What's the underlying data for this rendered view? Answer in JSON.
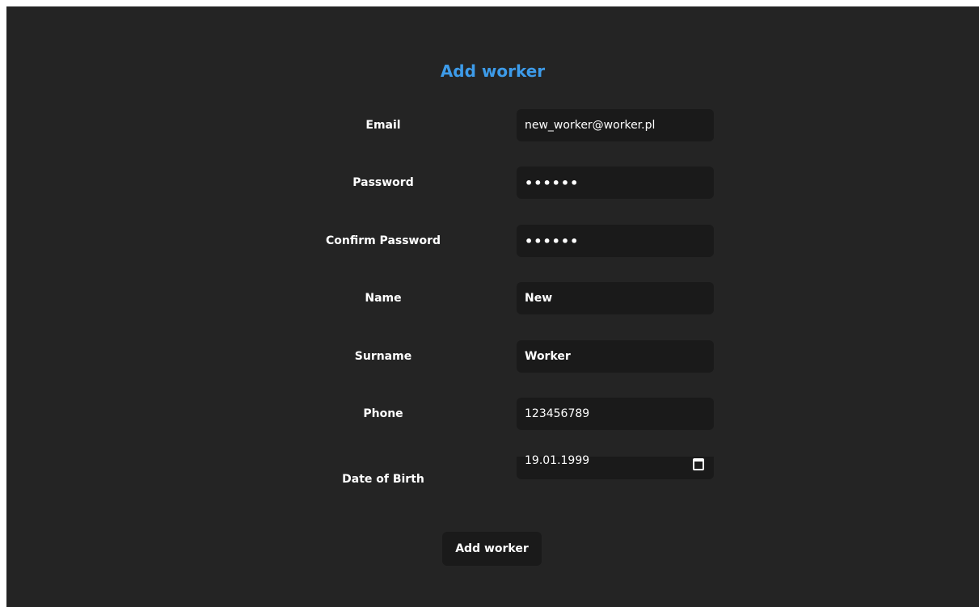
{
  "title": "Add worker",
  "fields": {
    "email": {
      "label": "Email",
      "value": "new_worker@worker.pl"
    },
    "password": {
      "label": "Password",
      "value": "••••••"
    },
    "confirm_password": {
      "label": "Confirm Password",
      "value": "••••••"
    },
    "name": {
      "label": "Name",
      "value": "New"
    },
    "surname": {
      "label": "Surname",
      "value": "Worker"
    },
    "phone": {
      "label": "Phone",
      "value": "123456789"
    },
    "date_of_birth": {
      "label": "Date of Birth",
      "value": "19.01.1999",
      "icon": "calendar-icon"
    }
  },
  "submit_label": "Add worker",
  "colors": {
    "title": "#3d9be9",
    "panel_background": "#242424",
    "field_background": "#1a1a1a",
    "text": "#ffffff"
  }
}
